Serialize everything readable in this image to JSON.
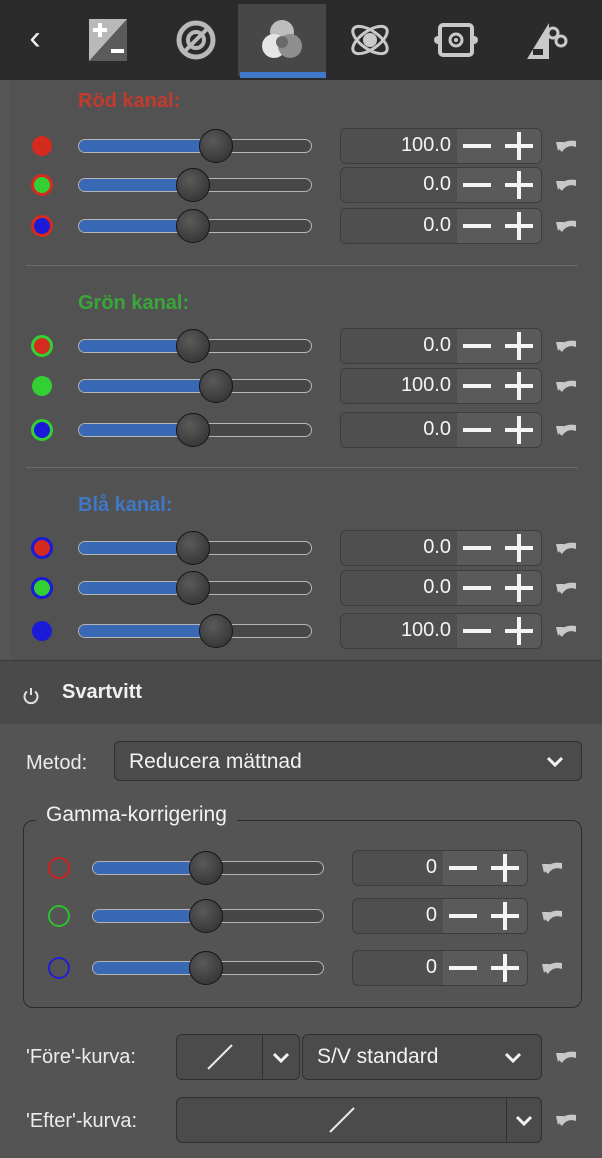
{
  "toolbar": {
    "back_icon": "chevron-left-icon",
    "tabs": [
      {
        "icon": "exposure-icon",
        "active": false
      },
      {
        "icon": "detail-icon",
        "active": false
      },
      {
        "icon": "color-icon",
        "active": true
      },
      {
        "icon": "advanced-icon",
        "active": false
      },
      {
        "icon": "transform-icon",
        "active": false
      },
      {
        "icon": "raw-icon",
        "active": false
      }
    ]
  },
  "mixer": {
    "red": {
      "title": "Röd kanal:",
      "color": "#c43a2c",
      "rows": [
        {
          "value": "100.0",
          "slider_fraction": 0.59
        },
        {
          "value": "0.0",
          "slider_fraction": 0.49
        },
        {
          "value": "0.0",
          "slider_fraction": 0.49
        }
      ]
    },
    "green": {
      "title": "Grön kanal:",
      "color": "#3aa63a",
      "rows": [
        {
          "value": "0.0",
          "slider_fraction": 0.49
        },
        {
          "value": "100.0",
          "slider_fraction": 0.59
        },
        {
          "value": "0.0",
          "slider_fraction": 0.49
        }
      ]
    },
    "blue": {
      "title": "Blå kanal:",
      "color": "#3f78c8",
      "rows": [
        {
          "value": "0.0",
          "slider_fraction": 0.49
        },
        {
          "value": "0.0",
          "slider_fraction": 0.49
        },
        {
          "value": "100.0",
          "slider_fraction": 0.59
        }
      ]
    }
  },
  "bw": {
    "title": "Svartvitt",
    "method_label": "Metod:",
    "method_value": "Reducera mättnad",
    "gamma": {
      "title": "Gamma-korrigering",
      "rows": [
        {
          "value": "0",
          "color": "#d22020",
          "slider_fraction": 0.49
        },
        {
          "value": "0",
          "color": "#2ec02e",
          "slider_fraction": 0.49
        },
        {
          "value": "0",
          "color": "#2020d0",
          "slider_fraction": 0.49
        }
      ]
    },
    "before_label": "'Före'-kurva:",
    "before_curve_value": "S/V standard",
    "after_label": "'Efter'-kurva:"
  },
  "colors": {
    "red": "#d42a20",
    "green": "#33d033",
    "blue": "#1a1ad8",
    "accent": "#3968b4"
  }
}
